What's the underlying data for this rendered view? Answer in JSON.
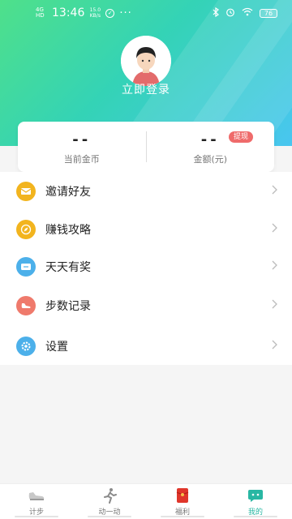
{
  "status_bar": {
    "signal": "4G HD",
    "time": "13:46",
    "speed": "15.0 KB/s",
    "more": "···",
    "battery": "76"
  },
  "profile": {
    "login_label": "立即登录"
  },
  "stats": {
    "coins_value": "--",
    "coins_label": "当前金币",
    "amount_value": "--",
    "amount_label": "金额(元)",
    "withdraw_badge": "提现"
  },
  "menu": [
    {
      "label": "邀请好友",
      "icon": "envelope-icon",
      "color": "#f2b41e"
    },
    {
      "label": "赚钱攻略",
      "icon": "compass-icon",
      "color": "#f2b41e"
    },
    {
      "label": "天天有奖",
      "icon": "ticket-icon",
      "color": "#4cb0ea"
    },
    {
      "label": "步数记录",
      "icon": "shoe-icon",
      "color": "#ef7a6c"
    },
    {
      "label": "设置",
      "icon": "gear-icon",
      "color": "#4cb0ea"
    }
  ],
  "tabs": [
    {
      "label": "计步",
      "icon": "sneaker-icon",
      "active": false
    },
    {
      "label": "动一动",
      "icon": "runner-icon",
      "active": false
    },
    {
      "label": "福利",
      "icon": "red-envelope-icon",
      "active": false
    },
    {
      "label": "我的",
      "icon": "smile-bubble-icon",
      "active": true
    }
  ],
  "colors": {
    "accent": "#29b7a3",
    "gradient_start": "#4fe08a",
    "gradient_end": "#49c6f0",
    "badge": "#ef6b6b"
  }
}
